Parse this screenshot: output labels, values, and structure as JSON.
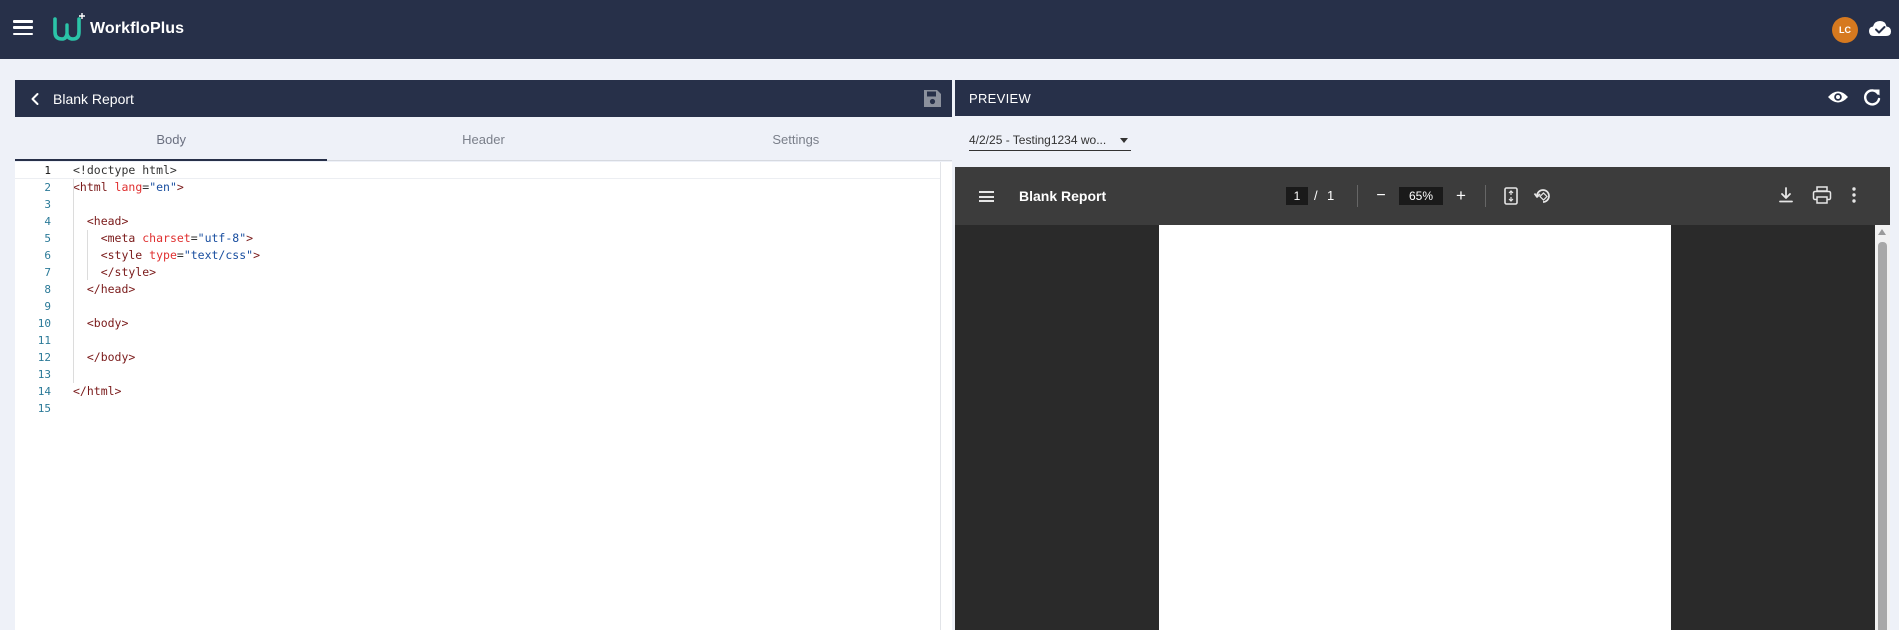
{
  "app": {
    "name": "WorkfloPlus",
    "user_initials": "LC"
  },
  "icons": {
    "menu": "hamburger-menu-icon",
    "logo": "workfloplus-logo-icon",
    "sync": "cloud-check-icon",
    "back": "chevron-left-icon",
    "save": "floppy-disk-icon",
    "preview": "eye-icon",
    "refresh": "refresh-icon",
    "download": "download-icon",
    "print": "print-icon",
    "more": "more-vertical-icon",
    "fit": "fit-page-icon",
    "rotate": "rotate-icon"
  },
  "colors": {
    "nav": "#273049",
    "accent": "#2bc4a8",
    "avatar": "#d6791f"
  },
  "editor": {
    "title": "Blank Report",
    "tabs": [
      {
        "label": "Body",
        "active": true
      },
      {
        "label": "Header",
        "active": false
      },
      {
        "label": "Settings",
        "active": false
      }
    ],
    "lines": [
      {
        "n": "1",
        "text": "<!doctype html>"
      },
      {
        "n": "2",
        "text": "<html lang=\"en\">"
      },
      {
        "n": "3",
        "text": ""
      },
      {
        "n": "4",
        "text": "  <head>"
      },
      {
        "n": "5",
        "text": "    <meta charset=\"utf-8\">"
      },
      {
        "n": "6",
        "text": "    <style type=\"text/css\">"
      },
      {
        "n": "7",
        "text": "    </style>"
      },
      {
        "n": "8",
        "text": "  </head>"
      },
      {
        "n": "9",
        "text": ""
      },
      {
        "n": "10",
        "text": "  <body>"
      },
      {
        "n": "11",
        "text": ""
      },
      {
        "n": "12",
        "text": "  </body>"
      },
      {
        "n": "13",
        "text": ""
      },
      {
        "n": "14",
        "text": "</html>"
      },
      {
        "n": "15",
        "text": ""
      }
    ]
  },
  "preview": {
    "label": "PREVIEW",
    "dataset_selected": "4/2/25 - Testing1234 wo...",
    "pdf": {
      "title": "Blank Report",
      "page": "1",
      "separator": "/",
      "total_pages": "1",
      "zoom": "65%",
      "zoom_out": "−",
      "zoom_in": "+"
    }
  }
}
